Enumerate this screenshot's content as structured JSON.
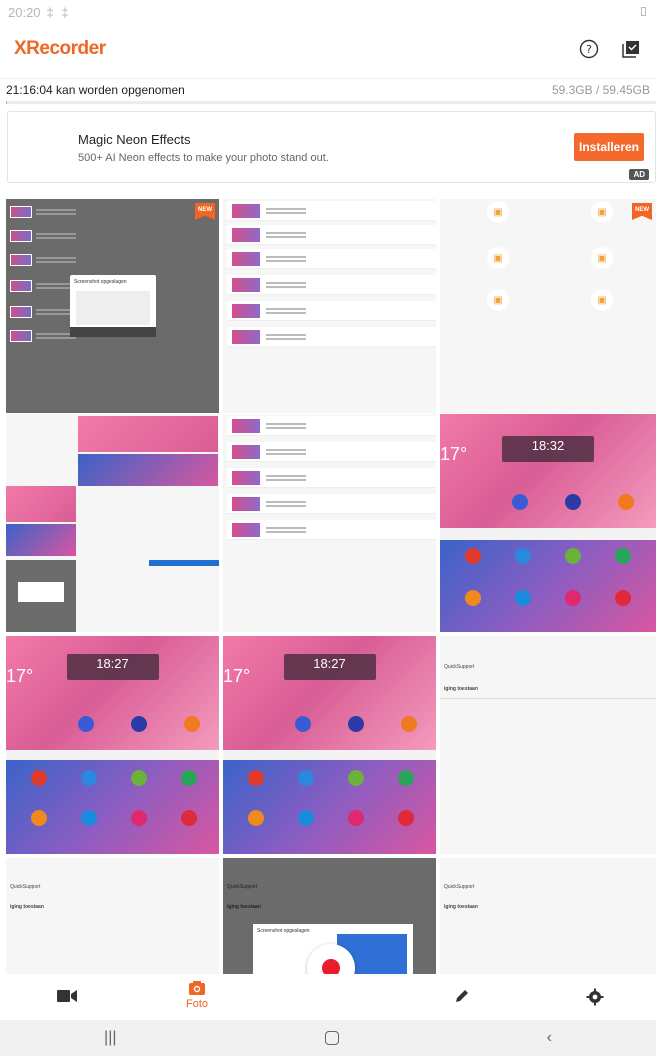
{
  "status": {
    "time": "20:20",
    "icons": "‡ ‡"
  },
  "app": {
    "title": "XRecorder"
  },
  "storage": {
    "left": "21:16:04  kan worden opgenomen",
    "right": "59.3GB / 59.45GB",
    "progress_fraction": 0.002
  },
  "ad": {
    "title": "Magic Neon Effects",
    "subtitle": "500+ AI Neon effects to make your photo stand out.",
    "install_label": "Installeren",
    "badge": "AD"
  },
  "tiles": {
    "new_badge": "NEW",
    "clock_a": "18:32",
    "clock_b": "18:27",
    "clock_c": "18:27",
    "temp": "17°",
    "dialog_title": "Screenshot opgeslagen",
    "quicksupport": "QuickSupport",
    "showing": "iging toestaan"
  },
  "bottom_nav": {
    "foto_label": "Foto"
  },
  "colors": {
    "accent": "#f06622",
    "record": "#ea1c2c"
  }
}
